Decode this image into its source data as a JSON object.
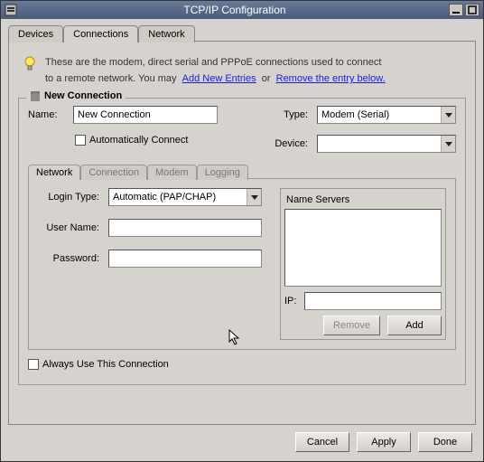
{
  "window": {
    "title": "TCP/IP Configuration"
  },
  "tabs": {
    "devices": "Devices",
    "connections": "Connections",
    "network": "Network"
  },
  "intro": {
    "text1": "These are the modem, direct serial and PPPoE connections used to connect",
    "text2a": "to a remote network. You may",
    "link_add": "Add New Entries",
    "text2b": "or",
    "link_remove": "Remove the entry below."
  },
  "group": {
    "title": "New Connection",
    "name_label": "Name:",
    "name_value": "New Connection",
    "auto_label": "Automatically Connect",
    "type_label": "Type:",
    "type_value": "Modem (Serial)",
    "device_label": "Device:",
    "device_value": ""
  },
  "subtabs": {
    "network": "Network",
    "connection": "Connection",
    "modem": "Modem",
    "logging": "Logging"
  },
  "net": {
    "login_type_label": "Login Type:",
    "login_type_value": "Automatic (PAP/CHAP)",
    "user_label": "User Name:",
    "user_value": "",
    "pass_label": "Password:",
    "pass_value": "",
    "ns_title": "Name Servers",
    "ip_label": "IP:",
    "ip_value": "",
    "remove_btn": "Remove",
    "add_btn": "Add"
  },
  "always_label": "Always Use This Connection",
  "buttons": {
    "cancel": "Cancel",
    "apply": "Apply",
    "done": "Done"
  }
}
